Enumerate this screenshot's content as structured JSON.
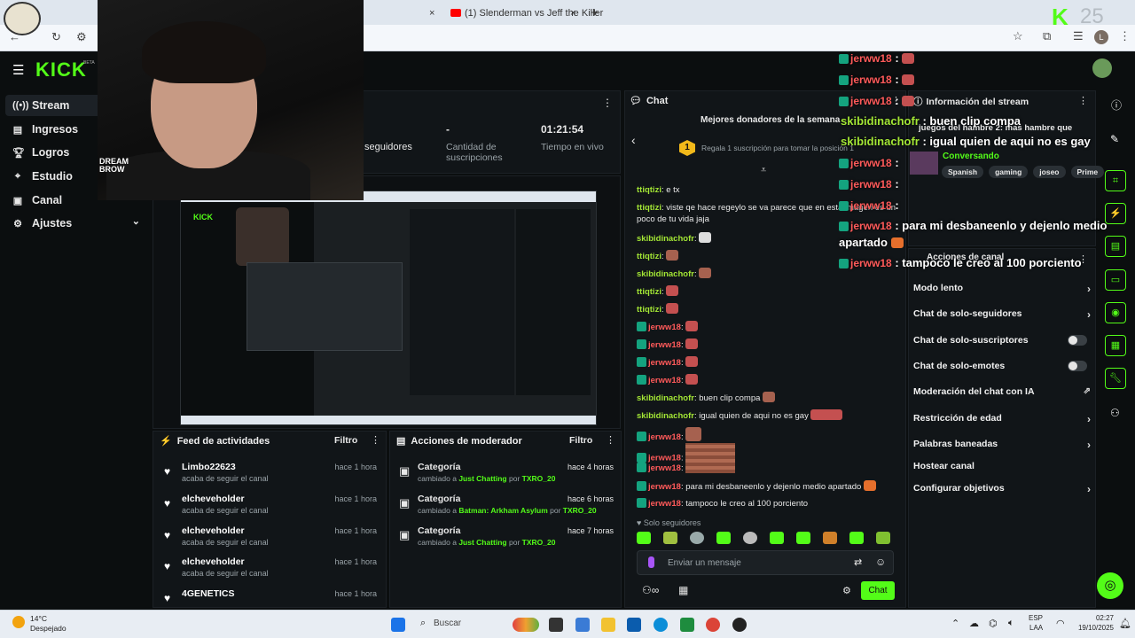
{
  "browser": {
    "tab1_title": "(1) Slenderman vs Jeff the Killer",
    "tab_close": "×",
    "new_tab": "+",
    "profile_initial": "L",
    "corner_logo_text": "K",
    "corner_number": "25"
  },
  "app": {
    "logo": "KICK",
    "logo_badge": "BETA"
  },
  "sidebar": {
    "items": [
      {
        "label": "Stream",
        "icon": "stream-icon"
      },
      {
        "label": "Ingresos",
        "icon": "money-icon"
      },
      {
        "label": "Logros",
        "icon": "trophy-icon"
      },
      {
        "label": "Estudio",
        "icon": "studio-icon"
      },
      {
        "label": "Canal",
        "icon": "channel-icon"
      },
      {
        "label": "Ajustes",
        "icon": "gear-icon"
      }
    ]
  },
  "webcam": {
    "shirt_text": "DREAM BROW"
  },
  "stats": {
    "followers_label": "seguidores",
    "subs_value": "-",
    "subs_label": "Cantidad de suscripciones",
    "live_time": "01:21:54",
    "live_label": "Tiempo en vivo"
  },
  "feed": {
    "title": "Feed de actividades",
    "filter": "Filtro",
    "items": [
      {
        "name": "Limbo22623",
        "sub": "acaba de seguir el canal",
        "time": "hace 1 hora"
      },
      {
        "name": "elcheveholder",
        "sub": "acaba de seguir el canal",
        "time": "hace 1 hora"
      },
      {
        "name": "elcheveholder",
        "sub": "acaba de seguir el canal",
        "time": "hace 1 hora"
      },
      {
        "name": "elcheveholder",
        "sub": "acaba de seguir el canal",
        "time": "hace 1 hora"
      },
      {
        "name": "4GENETICS",
        "sub": "",
        "time": "hace 1 hora"
      }
    ]
  },
  "modactions": {
    "title": "Acciones de moderador",
    "filter": "Filtro",
    "items": [
      {
        "title": "Categoría",
        "pre": "cambiado a ",
        "cat": "Just Chatting",
        "por": " por ",
        "user": "TXRO_20",
        "time": "hace 4 horas"
      },
      {
        "title": "Categoría",
        "pre": "cambiado a ",
        "cat": "Batman: Arkham Asylum",
        "por": " por ",
        "user": "TXRO_20",
        "time": "hace 6 horas"
      },
      {
        "title": "Categoría",
        "pre": "cambiado a ",
        "cat": "Just Chatting",
        "por": " por ",
        "user": "TXRO_20",
        "time": "hace 7 horas"
      }
    ]
  },
  "chat": {
    "title": "Chat",
    "top_donors": "Mejores donadores de la semana",
    "gift_prompt": "Regala 1 suscripción para tomar la posición 1",
    "gift_rank": "1",
    "lines": [
      {
        "user": "ttiqtizi",
        "text": "e tx",
        "cls": "u1"
      },
      {
        "user": "ttiqtizi",
        "text": "viste qe hace regeylo se va parece que en esta imagen es un",
        "cls": "u1"
      },
      {
        "user": "",
        "text": "poco de tu vida jaja",
        "cls": "u1"
      },
      {
        "user": "skibidinachofr",
        "text": "",
        "cls": "u1"
      },
      {
        "user": "ttiqtizi",
        "text": "",
        "cls": "u1"
      },
      {
        "user": "skibidinachofr",
        "text": "",
        "cls": "u1"
      },
      {
        "user": "ttiqtizi",
        "text": "",
        "cls": "u1"
      },
      {
        "user": "ttiqtizi",
        "text": "",
        "cls": "u1"
      },
      {
        "user": "jerww18",
        "text": "",
        "cls": "u3"
      },
      {
        "user": "jerww18",
        "text": "",
        "cls": "u3"
      },
      {
        "user": "jerww18",
        "text": "",
        "cls": "u3"
      },
      {
        "user": "jerww18",
        "text": "",
        "cls": "u3"
      },
      {
        "user": "skibidinachofr",
        "text": "buen clip compa",
        "cls": "u1"
      },
      {
        "user": "skibidinachofr",
        "text": "igual quien de aqui no es gay",
        "cls": "u1"
      },
      {
        "user": "jerww18",
        "text": "",
        "cls": "u3"
      },
      {
        "user": "jerww18",
        "text": "",
        "cls": "u3"
      },
      {
        "user": "jerww18",
        "text": "",
        "cls": "u3"
      },
      {
        "user": "jerww18",
        "text": "para mi desbaneenlo y dejenlo medio apartado",
        "cls": "u3"
      },
      {
        "user": "jerww18",
        "text": "tampoco le creo al 100 porciento",
        "cls": "u3"
      }
    ],
    "followers_only": "Solo seguidores",
    "input_placeholder": "Enviar un mensaje",
    "send_label": "Chat"
  },
  "overlay": {
    "lines": [
      {
        "user": "jerww18",
        "text": ""
      },
      {
        "user": "jerww18",
        "text": ""
      },
      {
        "user": "jerww18",
        "text": ""
      },
      {
        "user": "skibidinachofr",
        "text": "buen clip compa"
      },
      {
        "user": "skibidinachofr",
        "text": "igual quien de aqui no es gay"
      },
      {
        "user": "jerww18",
        "text": ""
      },
      {
        "user": "jerww18",
        "text": ""
      },
      {
        "user": "jerww18",
        "text": ""
      },
      {
        "user": "jerww18",
        "text": "para mi desbaneenlo y dejenlo medio"
      },
      {
        "user": "",
        "text": "apartado"
      },
      {
        "user": "jerww18",
        "text": "tampoco le creo al 100 porciento"
      }
    ]
  },
  "streaminfo": {
    "title": "Información del stream",
    "stream_title": "juegos del hambre 2: mas hambre que",
    "category": "Conversando",
    "tags": [
      "Spanish",
      "gaming",
      "joseo",
      "Prime"
    ]
  },
  "channelactions": {
    "title": "Acciones de canal",
    "rows": [
      {
        "label": "Modo lento",
        "kind": "chevron"
      },
      {
        "label": "Chat de solo-seguidores",
        "kind": "chevron"
      },
      {
        "label": "Chat de solo-suscriptores",
        "kind": "toggle"
      },
      {
        "label": "Chat de solo-emotes",
        "kind": "toggle"
      },
      {
        "label": "Moderación del chat con IA",
        "kind": "external"
      },
      {
        "label": "Restricción de edad",
        "kind": "chevron"
      },
      {
        "label": "Palabras baneadas",
        "kind": "chevron"
      },
      {
        "label": "Hostear canal",
        "kind": "none"
      },
      {
        "label": "Configurar objetivos",
        "kind": "chevron"
      }
    ]
  },
  "taskbar": {
    "temp": "14°C",
    "weather": "Despejado",
    "search": "Buscar",
    "lang1": "ESP",
    "lang2": "LAA",
    "time": "02:27",
    "date": "19/10/2025"
  },
  "colors": {
    "brand": "#53fc18",
    "background": "#0b0e0f",
    "panel": "#111518"
  }
}
